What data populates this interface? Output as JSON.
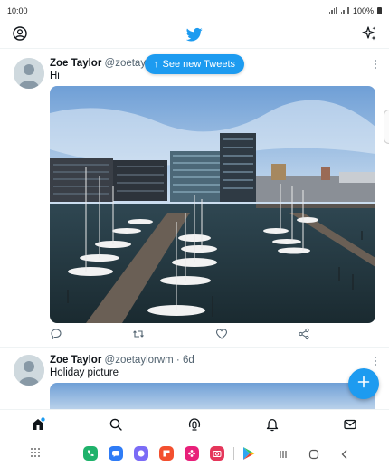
{
  "status_bar": {
    "time": "10:00",
    "battery": "100%"
  },
  "feed": {
    "new_tweets_pill": {
      "arrow": "↑",
      "label": "See new Tweets"
    },
    "tweets": [
      {
        "name": "Zoe Taylor",
        "handle": "@zoetaylo",
        "text": "Hi",
        "has_image": true,
        "image_subject": "harbour-marina-photo"
      },
      {
        "name": "Zoe Taylor",
        "handle": "@zoetaylorwm · 6d",
        "text": "Holiday picture",
        "has_image": true
      }
    ]
  },
  "colors": {
    "brand": "#1d9bf0",
    "text": "#0f1419",
    "secondary_text": "#536471"
  },
  "icons": {
    "top_bar": [
      "profile-icon",
      "twitter-bird-icon",
      "sparkle-icon"
    ],
    "actions": [
      "reply-icon",
      "retweet-icon",
      "like-icon",
      "share-icon"
    ],
    "bottom_nav": [
      "home-icon",
      "search-icon",
      "spaces-icon",
      "notifications-icon",
      "messages-icon"
    ],
    "system": [
      "app-drawer-icon",
      "phone-app-icon",
      "messages-app-icon",
      "chat-app-icon",
      "flipboard-app-icon",
      "flower-app-icon",
      "camera-app-icon",
      "play-store-icon",
      "recents-icon",
      "home-button-icon",
      "back-icon"
    ]
  }
}
